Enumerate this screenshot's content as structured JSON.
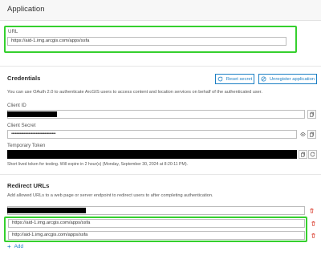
{
  "application": {
    "title": "Application"
  },
  "url_section": {
    "label": "URL",
    "value": "https://aid-1.img.arcgis.com/apps/ssfa"
  },
  "credentials": {
    "title": "Credentials",
    "reset_label": "Reset secret",
    "unregister_label": "Unregister application",
    "description": "You can use OAuth 2.0 to authenticate ArcGIS users to access content and location services on behalf of the authenticated user.",
    "client_id_label": "Client ID",
    "client_secret_label": "Client Secret",
    "client_secret_value": "••••••••••••••••••••••••••••••••••••",
    "token_label": "Temporary Token",
    "token_note": "Short lived token for testing. Will expire in 2 hour(s) (Monday, September 30, 2024 at 8:20:11 PM)."
  },
  "redirect": {
    "title": "Redirect URLs",
    "description": "Add allowed URLs to a web page or server endpoint to redirect users to after completing authentication.",
    "urls": [
      "https://aid-1.img.arcgis.com/apps/ssfa",
      "http://aid-1.img.arcgis.com/apps/ssfa"
    ],
    "add_label": "Add"
  },
  "colors": {
    "accent": "#1b7fc4",
    "highlight": "#35d02e",
    "danger": "#d83020"
  }
}
